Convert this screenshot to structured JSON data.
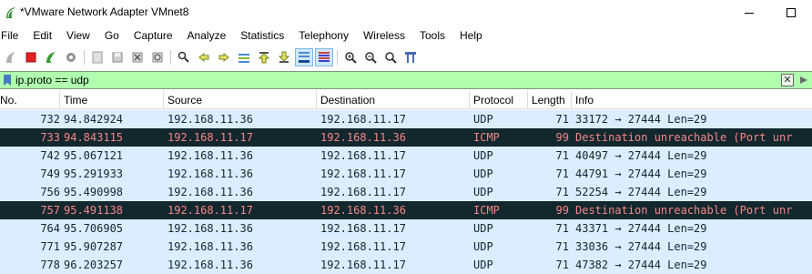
{
  "window": {
    "title": "*VMware Network Adapter VMnet8"
  },
  "menu": [
    "File",
    "Edit",
    "View",
    "Go",
    "Capture",
    "Analyze",
    "Statistics",
    "Telephony",
    "Wireless",
    "Tools",
    "Help"
  ],
  "toolbar": {
    "icons": [
      "start-capture-icon",
      "stop-capture-icon",
      "restart-capture-icon",
      "capture-options-icon",
      "open-file-icon",
      "save-file-icon",
      "close-file-icon",
      "reload-file-icon",
      "find-packet-icon",
      "go-back-icon",
      "go-forward-icon",
      "go-to-packet-icon",
      "go-first-icon",
      "go-last-icon",
      "auto-scroll-icon",
      "colorize-icon",
      "zoom-in-icon",
      "zoom-out-icon",
      "zoom-normal-icon",
      "resize-columns-icon"
    ]
  },
  "filter": {
    "value": "ip.proto == udp",
    "color": "#afffaf"
  },
  "columns": {
    "no": "No.",
    "time": "Time",
    "source": "Source",
    "destination": "Destination",
    "protocol": "Protocol",
    "length": "Length",
    "info": "Info"
  },
  "colors": {
    "udp_bg": "#daeeff",
    "udp_fg": "#12272e",
    "icmp_bg": "#12272e",
    "icmp_fg": "#f78787"
  },
  "packets": [
    {
      "no": "732",
      "time": "94.842924",
      "source": "192.168.11.36",
      "destination": "192.168.11.17",
      "protocol": "UDP",
      "length": "71",
      "info": "33172 → 27444 Len=29",
      "kind": "udp"
    },
    {
      "no": "733",
      "time": "94.843115",
      "source": "192.168.11.17",
      "destination": "192.168.11.36",
      "protocol": "ICMP",
      "length": "99",
      "info": "Destination unreachable (Port unr",
      "kind": "icmp"
    },
    {
      "no": "742",
      "time": "95.067121",
      "source": "192.168.11.36",
      "destination": "192.168.11.17",
      "protocol": "UDP",
      "length": "71",
      "info": "40497 → 27444 Len=29",
      "kind": "udp"
    },
    {
      "no": "749",
      "time": "95.291933",
      "source": "192.168.11.36",
      "destination": "192.168.11.17",
      "protocol": "UDP",
      "length": "71",
      "info": "44791 → 27444 Len=29",
      "kind": "udp"
    },
    {
      "no": "756",
      "time": "95.490998",
      "source": "192.168.11.36",
      "destination": "192.168.11.17",
      "protocol": "UDP",
      "length": "71",
      "info": "52254 → 27444 Len=29",
      "kind": "udp"
    },
    {
      "no": "757",
      "time": "95.491138",
      "source": "192.168.11.17",
      "destination": "192.168.11.36",
      "protocol": "ICMP",
      "length": "99",
      "info": "Destination unreachable (Port unr",
      "kind": "icmp"
    },
    {
      "no": "764",
      "time": "95.706905",
      "source": "192.168.11.36",
      "destination": "192.168.11.17",
      "protocol": "UDP",
      "length": "71",
      "info": "43371 → 27444 Len=29",
      "kind": "udp"
    },
    {
      "no": "771",
      "time": "95.907287",
      "source": "192.168.11.36",
      "destination": "192.168.11.17",
      "protocol": "UDP",
      "length": "71",
      "info": "33036 → 27444 Len=29",
      "kind": "udp"
    },
    {
      "no": "778",
      "time": "96.203257",
      "source": "192.168.11.36",
      "destination": "192.168.11.17",
      "protocol": "UDP",
      "length": "71",
      "info": "47382 → 27444 Len=29",
      "kind": "udp"
    }
  ]
}
